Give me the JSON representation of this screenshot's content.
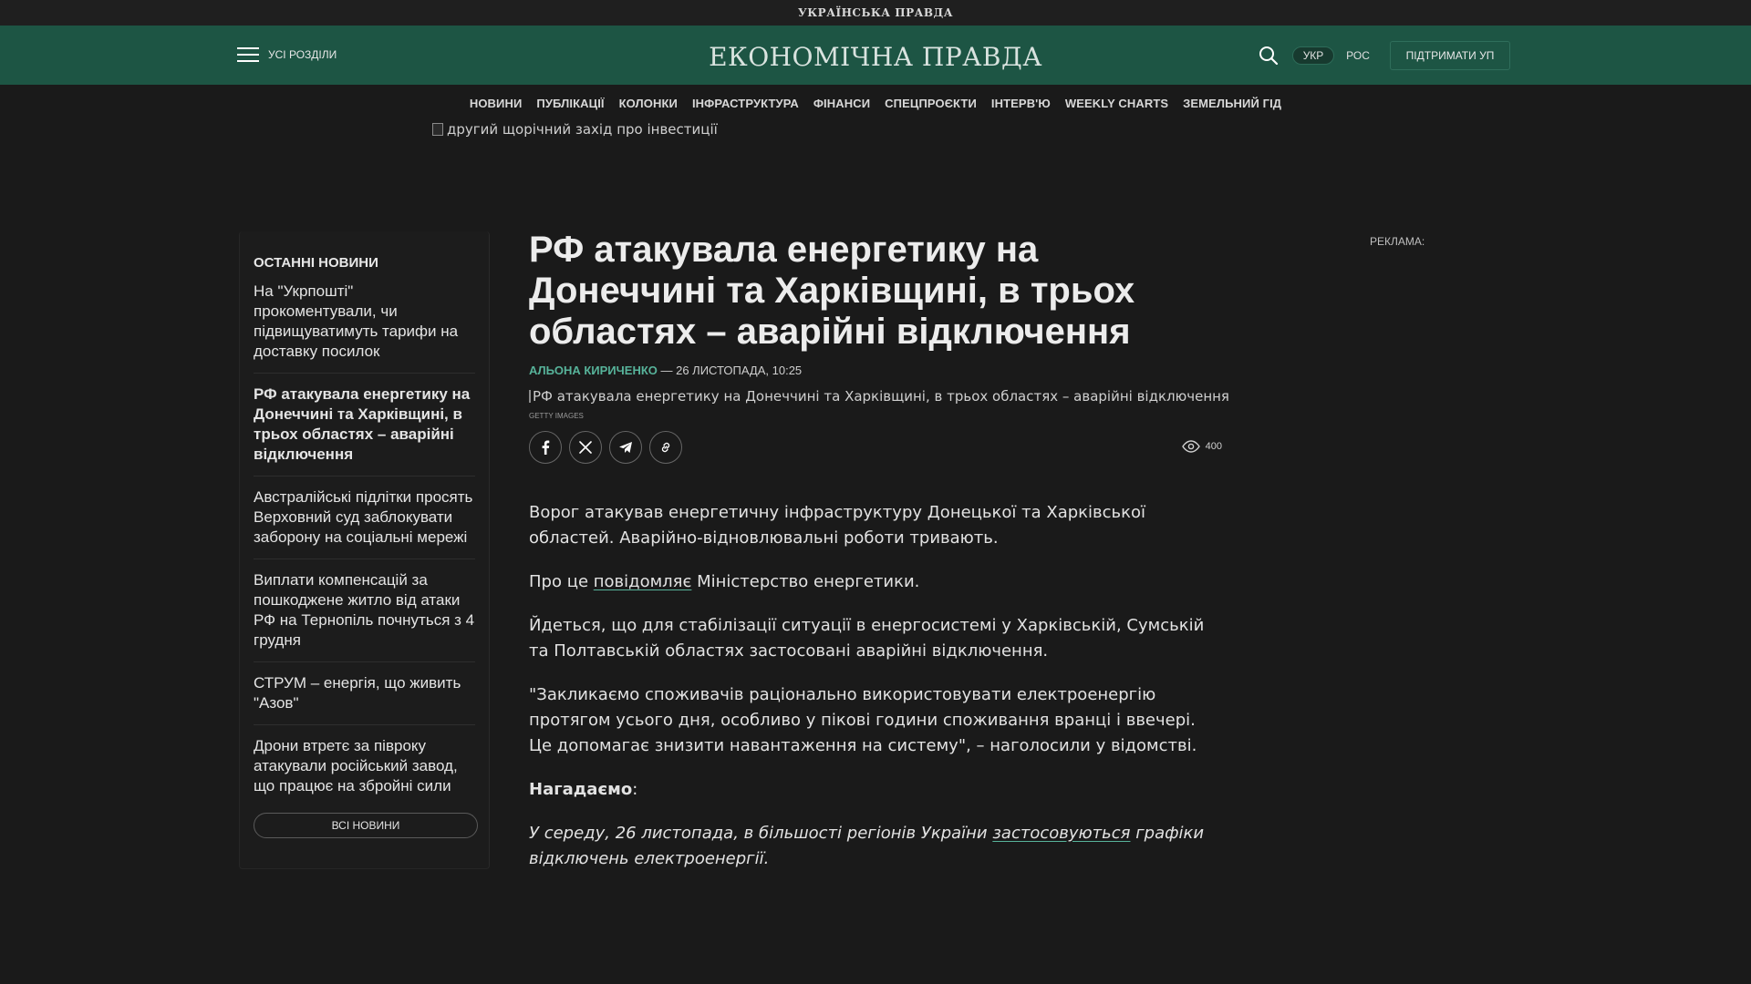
{
  "topbar": {
    "logo": "УКРАЇНСЬКА ПРАВДА"
  },
  "header": {
    "menu_label": "УСІ РОЗДІЛИ",
    "logo": "ЕКОНОМІЧНА ПРАВДА",
    "lang_active": "УКР",
    "lang_other": "РОС",
    "support_label": "ПІДТРИМАТИ УП"
  },
  "nav": {
    "items": [
      {
        "label": "НОВИНИ"
      },
      {
        "label": "ПУБЛІКАЦІЇ"
      },
      {
        "label": "КОЛОНКИ"
      },
      {
        "label": "ІНФРАСТРУКТУРА"
      },
      {
        "label": "ФІНАНСИ"
      },
      {
        "label": "СПЕЦПРОЄКТИ"
      },
      {
        "label": "ІНТЕРВ'Ю"
      },
      {
        "label": "WEEKLY CHARTS"
      },
      {
        "label": "ЗЕМЕЛЬНИЙ ГІД"
      }
    ]
  },
  "banner": {
    "alt": "другий щорічний захід про інвестиції"
  },
  "sidebar": {
    "title": "ОСТАННІ НОВИНИ",
    "items": [
      {
        "text": "На \"Укрпошті\" прокоментували, чи підвищуватимуть тарифи на доставку посилок"
      },
      {
        "text": "РФ атакувала енергетику на Донеччині та Харківщині, в трьох областях – аварійні відключення"
      },
      {
        "text": "Австралійські підлітки просять Верховний суд заблокувати заборону на соціальні мережі"
      },
      {
        "text": "Виплати компенсацій за пошкоджене житло від атаки РФ на Тернопіль почнуться з 4 грудня"
      },
      {
        "text": "СТРУМ – енергія, що живить \"Азов\""
      },
      {
        "text": "Дрони втретє за півроку атакували російський завод, що працює на збройні сили"
      }
    ],
    "all_news_label": "ВСІ НОВИНИ"
  },
  "article": {
    "title": "РФ атакувала енергетику на Донеччині та Харківщині, в трьох областях – аварійні відключення",
    "author": "АЛЬОНА КИРИЧЕНКО",
    "date": " — 26 ЛИСТОПАДА, 10:25",
    "image_alt": "РФ атакувала енергетику на Донеччині та Харківщині, в трьох областях – аварійні відключення",
    "image_credit": "GETTY IMAGES",
    "views": "400",
    "p1": "Ворог атакував енергетичну інфраструктуру Донецької та Харківської областей. Аварійно-відновлювальні роботи тривають.",
    "p2_before": "Про це ",
    "p2_link": "повідомляє",
    "p2_after": " Міністерство енергетики.",
    "p3": "Йдеться, що для стабілізації ситуації в енергосистемі у Харківській, Сумській та Полтавській областях застосовані аварійні відключення.",
    "p4": "\"Закликаємо споживачів раціонально використовувати електроенергію протягом усього дня, особливо у пікові години споживання вранці і ввечері. Це допомагає знизити навантаження на систему\", – наголосили у відомстві.",
    "p5_bold": "Нагадаємо",
    "p5_after": ":",
    "p6_before": "У середу, 26 листопада, в більшості регіонів України ",
    "p6_link": "застосовуються",
    "p6_after": " графіки відключень електроенергії."
  },
  "ad": {
    "label": "РЕКЛАМА:"
  },
  "colors": {
    "header_bg": "#1d5544",
    "accent": "#57b39a",
    "page_bg": "#1a1a1a"
  }
}
